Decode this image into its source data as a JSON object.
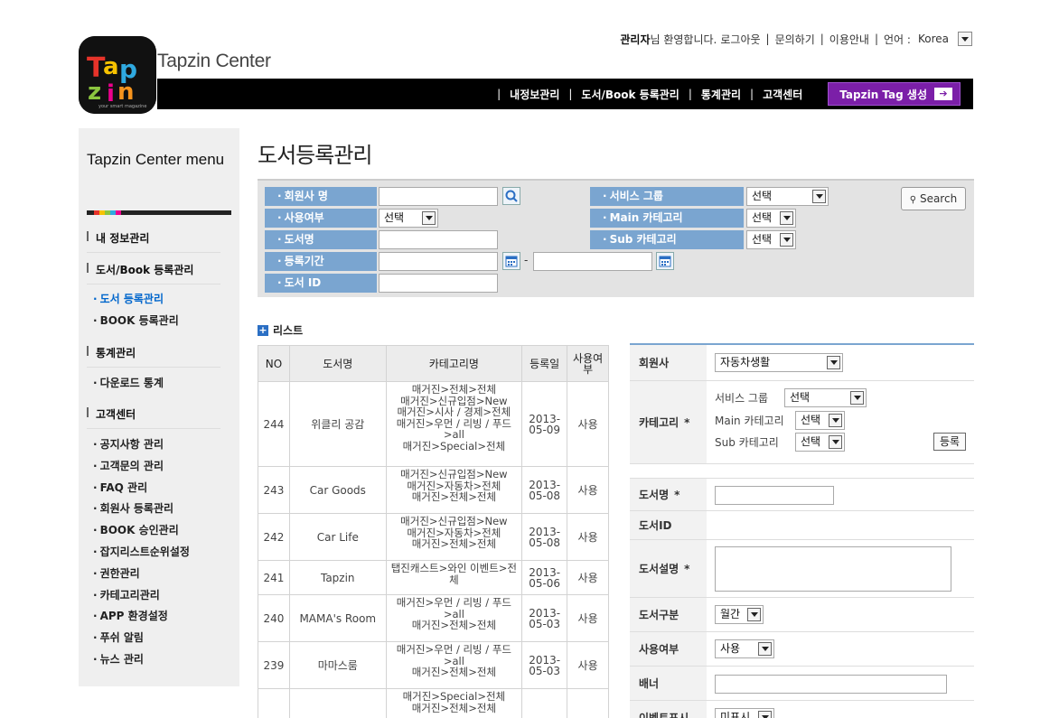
{
  "topbar": {
    "welcome_name": "관리자",
    "welcome_suffix": "님 환영합니다.",
    "logout": "로그아웃",
    "inquiry": "문의하기",
    "guide": "이용안내",
    "lang_label": "언어 :",
    "lang_value": "Korea"
  },
  "brand": {
    "logo_text": "Tapzin",
    "logo_tagline": "your smart magazine",
    "name": "Tapzin Center"
  },
  "nav": {
    "items": [
      "내정보관리",
      "도서/Book 등록관리",
      "통계관리",
      "고객센터"
    ],
    "tag_button": "Tapzin Tag 생성"
  },
  "sidebar": {
    "title": "Tapzin Center menu",
    "sec_myinfo": "내 정보관리",
    "sec_book": "도서/Book 등록관리",
    "book_items": [
      "도서 등록관리",
      "BOOK 등록관리"
    ],
    "sec_stats": "통계관리",
    "stats_items": [
      "다운로드 통계"
    ],
    "sec_cs": "고객센터",
    "cs_items": [
      "공지사항 관리",
      "고객문의 관리",
      "FAQ 관리",
      "회원사 등록관리",
      "BOOK 승인관리",
      "잡지리스트순위설정",
      "권한관리",
      "카테고리관리",
      "APP 환경설정",
      "푸쉬 알림",
      "뉴스 관리"
    ]
  },
  "page": {
    "title": "도서등록관리"
  },
  "search": {
    "member_label": "회원사 명",
    "use_label": "사용여부",
    "use_value": "선택",
    "title_label": "도서명",
    "period_label": "등록기간",
    "period_dash": "-",
    "id_label": "도서 ID",
    "service_label": "서비스 그룹",
    "service_value": "선택",
    "main_label": "Main 카테고리",
    "main_value": "선택",
    "sub_label": "Sub 카테고리",
    "sub_value": "선택",
    "search_button": "Search"
  },
  "list": {
    "heading": "리스트",
    "columns": [
      "NO",
      "도서명",
      "카테고리명",
      "등록일",
      "사용여부"
    ],
    "rows": [
      {
        "no": "244",
        "title": "위클리 공감",
        "category": "매거진>전체>전체\n매거진>신규입점>New\n매거진>시사 / 경제>전체\n매거진>우먼 / 리빙 / 푸드>all\n매거진>Special>전체",
        "date": "2013-05-09",
        "use": "사용"
      },
      {
        "no": "243",
        "title": "Car Goods",
        "category": "매거진>신규입점>New\n매거진>자동차>전체\n매거진>전체>전체",
        "date": "2013-05-08",
        "use": "사용"
      },
      {
        "no": "242",
        "title": "Car Life",
        "category": "매거진>신규입점>New\n매거진>자동차>전체\n매거진>전체>전체",
        "date": "2013-05-08",
        "use": "사용"
      },
      {
        "no": "241",
        "title": "Tapzin",
        "category": "탭진캐스트>와인 이벤트>전체",
        "date": "2013-05-06",
        "use": "사용"
      },
      {
        "no": "240",
        "title": "MAMA's Room",
        "category": "매거진>우먼 / 리빙 / 푸드>all\n매거진>전체>전체",
        "date": "2013-05-03",
        "use": "사용"
      },
      {
        "no": "239",
        "title": "마마스룸",
        "category": "매거진>우먼 / 리빙 / 푸드>all\n매거진>전체>전체",
        "date": "2013-05-03",
        "use": "사용"
      },
      {
        "no": "",
        "title": "",
        "category": "매거진>Special>전체\n매거진>전체>전체",
        "date": "",
        "use": ""
      }
    ]
  },
  "detail": {
    "member_label": "회원사",
    "member_value": "자동차생활",
    "category_label": "카테고리",
    "required_mark": "*",
    "service_label": "서비스 그룹",
    "service_value": "선택",
    "main_label": "Main 카테고리",
    "main_value": "선택",
    "sub_label": "Sub 카테고리",
    "sub_value": "선택",
    "register_button": "등록",
    "title_label": "도서명",
    "id_label": "도서ID",
    "desc_label": "도서설명",
    "type_label": "도서구분",
    "type_value": "월간",
    "use_label": "사용여부",
    "use_value": "사용",
    "banner_label": "배너",
    "event_label": "이벤트표시",
    "event_value": "미표시"
  },
  "colors": {
    "label_blue": "#7aa5d0",
    "nav_black": "#000000",
    "tag_purple": "#7b1fa8",
    "active_link": "#0066cc"
  }
}
